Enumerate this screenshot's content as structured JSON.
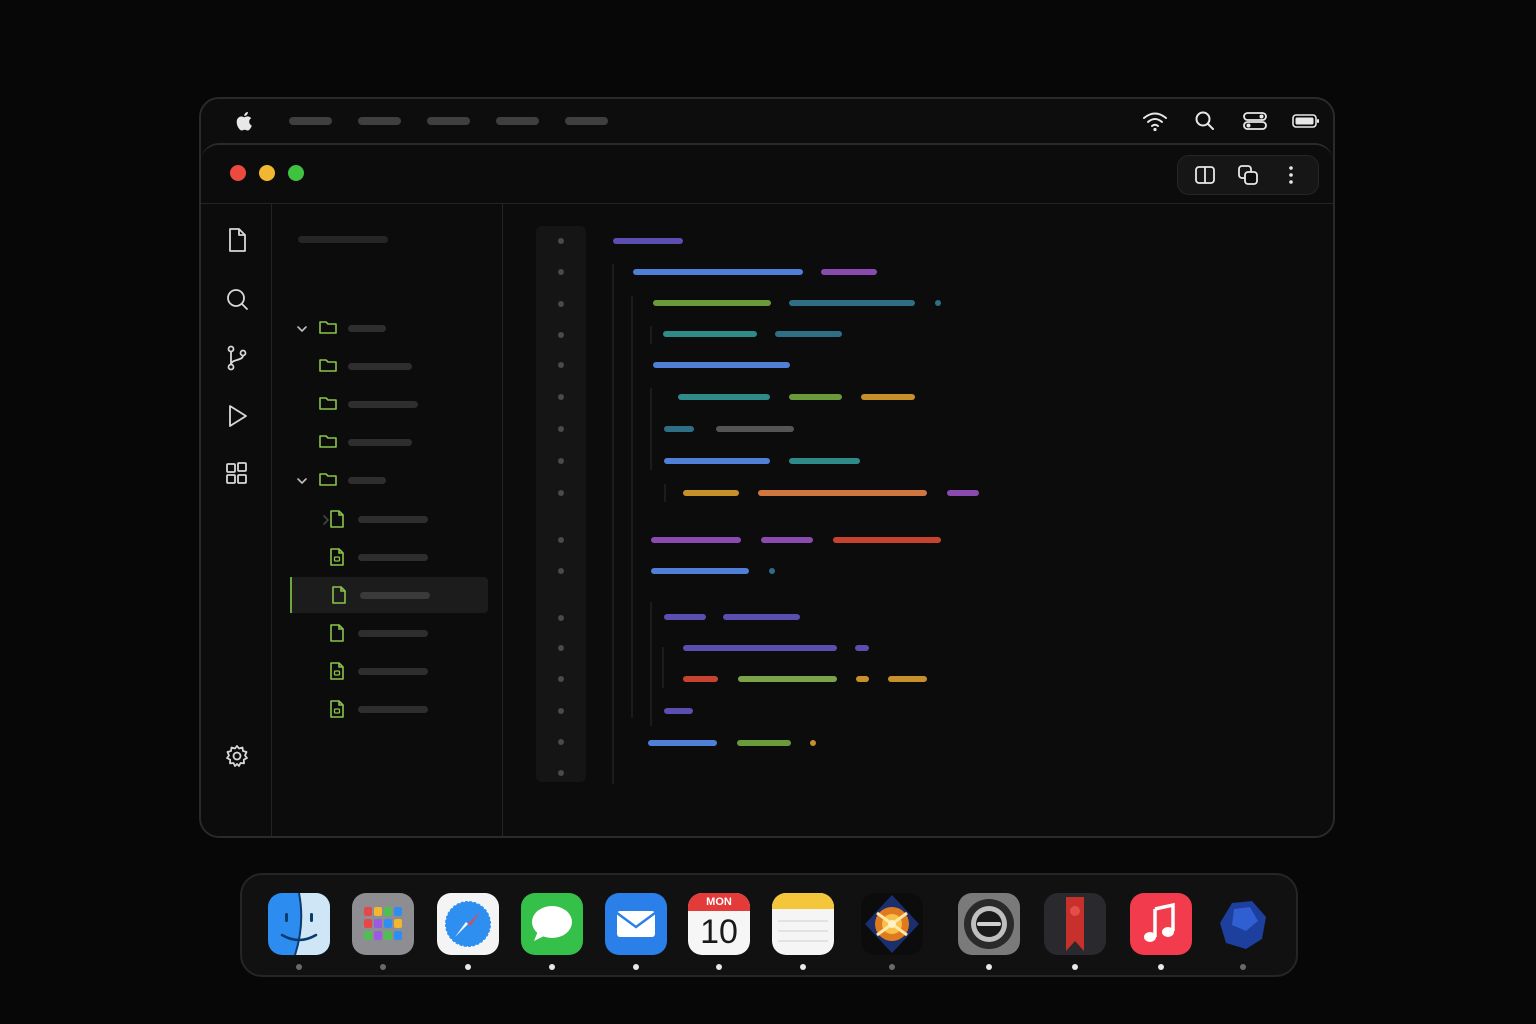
{
  "menubar": {
    "apple_icon": "apple-logo",
    "menu_item_count": 5,
    "status_icons": [
      "wifi-icon",
      "search-icon",
      "control-center-icon",
      "battery-icon"
    ]
  },
  "window": {
    "traffic_lights": {
      "close": "#ec4a3f",
      "minimize": "#f2b731",
      "zoom": "#3ec240"
    },
    "toolbar_icons": [
      "split-view-icon",
      "duplicate-window-icon",
      "more-icon"
    ],
    "activity_bar": [
      "file-icon",
      "search-icon",
      "source-control-icon",
      "run-icon",
      "extensions-icon"
    ],
    "settings_icon": "gear-icon",
    "accent": "#8bc34a"
  },
  "explorer": {
    "tree": [
      {
        "kind": "folder",
        "expanded": true
      },
      {
        "kind": "folder"
      },
      {
        "kind": "folder"
      },
      {
        "kind": "folder"
      },
      {
        "kind": "folder",
        "expanded": true
      },
      {
        "kind": "file",
        "collapsed": true
      },
      {
        "kind": "file-code"
      },
      {
        "kind": "file",
        "selected": true
      },
      {
        "kind": "file"
      },
      {
        "kind": "file-code"
      },
      {
        "kind": "file-code"
      }
    ]
  },
  "editor": {
    "line_count": 18,
    "token_colors": {
      "purple": "#5a4fb0",
      "blue": "#4f7fd6",
      "violet": "#8a4ab0",
      "green": "#6a9a3a",
      "teal": "#2f6f86",
      "cyan": "#2f8a8a",
      "gold": "#c8902a",
      "orange": "#d0763f",
      "red": "#c8432f",
      "gray": "#555555",
      "sage": "#7aa34a"
    }
  },
  "dock": {
    "apps": [
      {
        "name": "finder",
        "running": true
      },
      {
        "name": "launchpad",
        "running": true
      },
      {
        "name": "safari",
        "running": true
      },
      {
        "name": "messages",
        "running": true
      },
      {
        "name": "mail",
        "running": true
      },
      {
        "name": "calendar",
        "running": true,
        "day": "MON",
        "date": "10"
      },
      {
        "name": "notes",
        "running": true
      },
      {
        "name": "fractal-app",
        "running": true
      },
      {
        "name": "camera-app",
        "running": true
      },
      {
        "name": "bookmark-app",
        "running": true
      },
      {
        "name": "music",
        "running": true
      },
      {
        "name": "blue-orb-app",
        "running": true
      }
    ]
  }
}
